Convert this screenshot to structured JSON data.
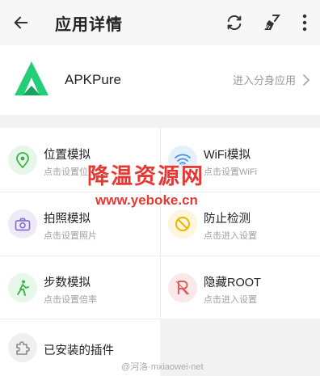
{
  "header": {
    "title": "应用详情",
    "back_icon": "arrow-left-icon",
    "actions": [
      "refresh-icon",
      "broom-icon",
      "more-vert-icon"
    ]
  },
  "app": {
    "name": "APKPure",
    "clone_label": "进入分身应用",
    "logo_color": "#24cd77"
  },
  "features": [
    {
      "label": "位置模拟",
      "sub": "点击设置位置",
      "icon": "location-pin-icon",
      "color": "#3bb54a",
      "bg": "#e6f6e8"
    },
    {
      "label": "WiFi模拟",
      "sub": "点击设置WiFi",
      "icon": "wifi-icon",
      "color": "#4a90e2",
      "bg": "#e6f0fb"
    },
    {
      "label": "拍照模拟",
      "sub": "点击设置照片",
      "icon": "camera-icon",
      "color": "#8b6fd1",
      "bg": "#efeaf8"
    },
    {
      "label": "防止检测",
      "sub": "点击进入设置",
      "icon": "block-icon",
      "color": "#f0b400",
      "bg": "#fdf5dc"
    },
    {
      "label": "步数模拟",
      "sub": "点击设置倍率",
      "icon": "walking-icon",
      "color": "#3bb54a",
      "bg": "#e6f6e8"
    },
    {
      "label": "隐藏ROOT",
      "sub": "点击进入设置",
      "icon": "root-r-icon",
      "color": "#e05a5a",
      "bg": "#fbe9e9"
    },
    {
      "label": "已安装的插件",
      "sub": "",
      "icon": "puzzle-icon",
      "color": "#8a8a8a",
      "bg": "#efefef"
    }
  ],
  "watermark": {
    "title": "降温资源网",
    "url": "www.yeboke.cn"
  },
  "credit": "@河洛·mxiaowei·net"
}
